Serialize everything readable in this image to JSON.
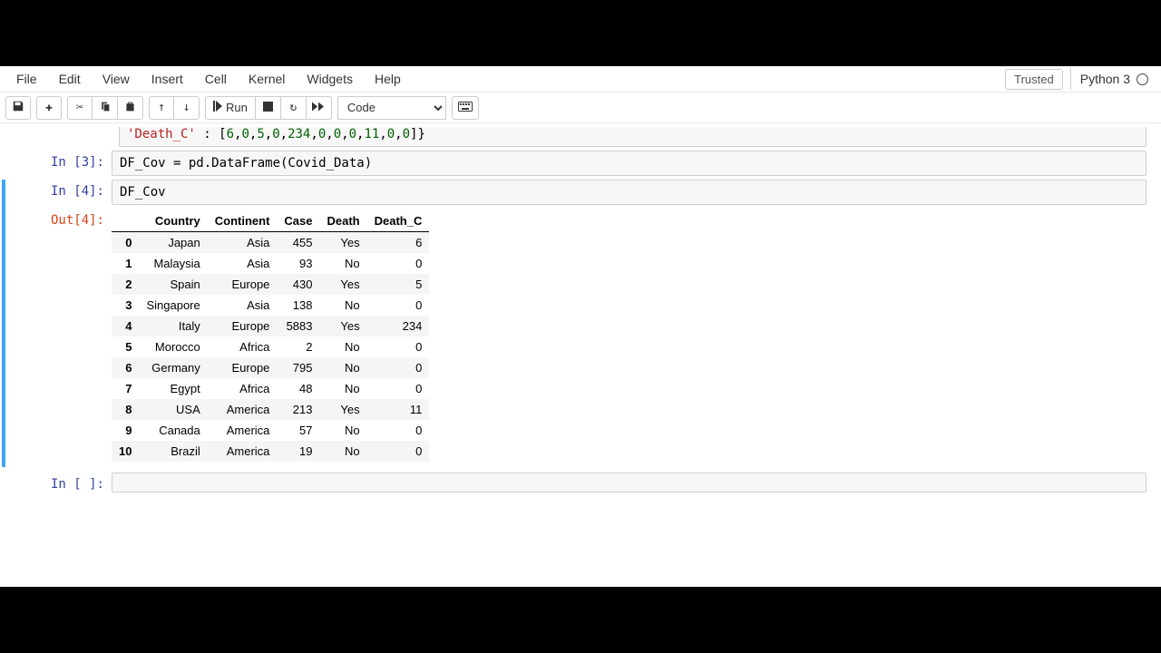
{
  "menubar": {
    "items": [
      "File",
      "Edit",
      "View",
      "Insert",
      "Cell",
      "Kernel",
      "Widgets",
      "Help"
    ],
    "trusted": "Trusted",
    "kernel": "Python 3"
  },
  "toolbar": {
    "save_title": "Save and Checkpoint",
    "add_title": "Insert cell below",
    "cut_title": "Cut",
    "copy_title": "Copy",
    "paste_title": "Paste",
    "up_title": "Move up",
    "down_title": "Move down",
    "run_label": "Run",
    "stop_title": "Interrupt",
    "restart_title": "Restart",
    "restart_run_title": "Restart and run all",
    "cell_type": "Code",
    "cmd_title": "Command palette"
  },
  "cells": {
    "partial": {
      "line": "'Death_C' : [6,0,5,0,234,0,0,0,11,0,0]}"
    },
    "c3": {
      "prompt": "In [3]:",
      "code": "DF_Cov = pd.DataFrame(Covid_Data)"
    },
    "c4": {
      "prompt": "In [4]:",
      "code": "DF_Cov",
      "out_prompt": "Out[4]:"
    },
    "empty": {
      "prompt": "In [ ]:"
    }
  },
  "dataframe": {
    "columns": [
      "Country",
      "Continent",
      "Case",
      "Death",
      "Death_C"
    ],
    "rows": [
      {
        "idx": "0",
        "Country": "Japan",
        "Continent": "Asia",
        "Case": "455",
        "Death": "Yes",
        "Death_C": "6"
      },
      {
        "idx": "1",
        "Country": "Malaysia",
        "Continent": "Asia",
        "Case": "93",
        "Death": "No",
        "Death_C": "0"
      },
      {
        "idx": "2",
        "Country": "Spain",
        "Continent": "Europe",
        "Case": "430",
        "Death": "Yes",
        "Death_C": "5"
      },
      {
        "idx": "3",
        "Country": "Singapore",
        "Continent": "Asia",
        "Case": "138",
        "Death": "No",
        "Death_C": "0"
      },
      {
        "idx": "4",
        "Country": "Italy",
        "Continent": "Europe",
        "Case": "5883",
        "Death": "Yes",
        "Death_C": "234"
      },
      {
        "idx": "5",
        "Country": "Morocco",
        "Continent": "Africa",
        "Case": "2",
        "Death": "No",
        "Death_C": "0"
      },
      {
        "idx": "6",
        "Country": "Germany",
        "Continent": "Europe",
        "Case": "795",
        "Death": "No",
        "Death_C": "0"
      },
      {
        "idx": "7",
        "Country": "Egypt",
        "Continent": "Africa",
        "Case": "48",
        "Death": "No",
        "Death_C": "0"
      },
      {
        "idx": "8",
        "Country": "USA",
        "Continent": "America",
        "Case": "213",
        "Death": "Yes",
        "Death_C": "11"
      },
      {
        "idx": "9",
        "Country": "Canada",
        "Continent": "America",
        "Case": "57",
        "Death": "No",
        "Death_C": "0"
      },
      {
        "idx": "10",
        "Country": "Brazil",
        "Continent": "America",
        "Case": "19",
        "Death": "No",
        "Death_C": "0"
      }
    ]
  }
}
